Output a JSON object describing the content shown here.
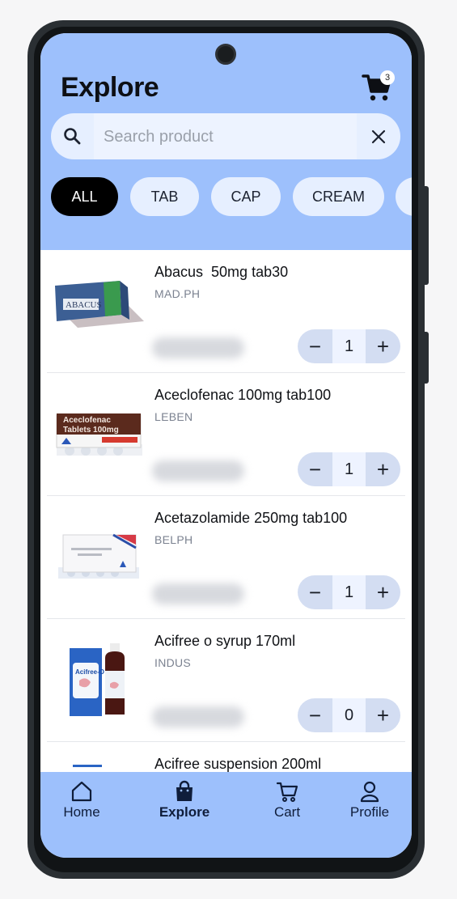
{
  "header": {
    "title": "Explore",
    "cart_count": "3"
  },
  "search": {
    "placeholder": "Search product",
    "value": ""
  },
  "filters": [
    {
      "label": "ALL",
      "active": true
    },
    {
      "label": "TAB",
      "active": false
    },
    {
      "label": "CAP",
      "active": false
    },
    {
      "label": "CREAM",
      "active": false
    }
  ],
  "products": [
    {
      "name": "Abacus  50mg tab30",
      "brand": "MAD.PH",
      "quantity": "1",
      "thumb": "box-green-icon"
    },
    {
      "name": "Aceclofenac 100mg tab100",
      "brand": "LEBEN",
      "quantity": "1",
      "thumb": "box-brown-icon"
    },
    {
      "name": "Acetazolamide 250mg tab100",
      "brand": "BELPH",
      "quantity": "1",
      "thumb": "box-white-icon"
    },
    {
      "name": "Acifree o syrup 170ml",
      "brand": "INDUS",
      "quantity": "0",
      "thumb": "syrup-bottle-icon"
    },
    {
      "name": "Acifree suspension 200ml",
      "brand": "",
      "quantity": "",
      "thumb": ""
    }
  ],
  "stepper": {
    "minus": "−",
    "plus": "+"
  },
  "nav": {
    "home": "Home",
    "explore": "Explore",
    "cart": "Cart",
    "profile": "Profile",
    "active": "explore"
  },
  "colors": {
    "header_bg": "#9dc0fc",
    "chip_active_bg": "#000000",
    "chip_bg": "#e6efff",
    "stepper_bg": "#d3ddf2"
  }
}
